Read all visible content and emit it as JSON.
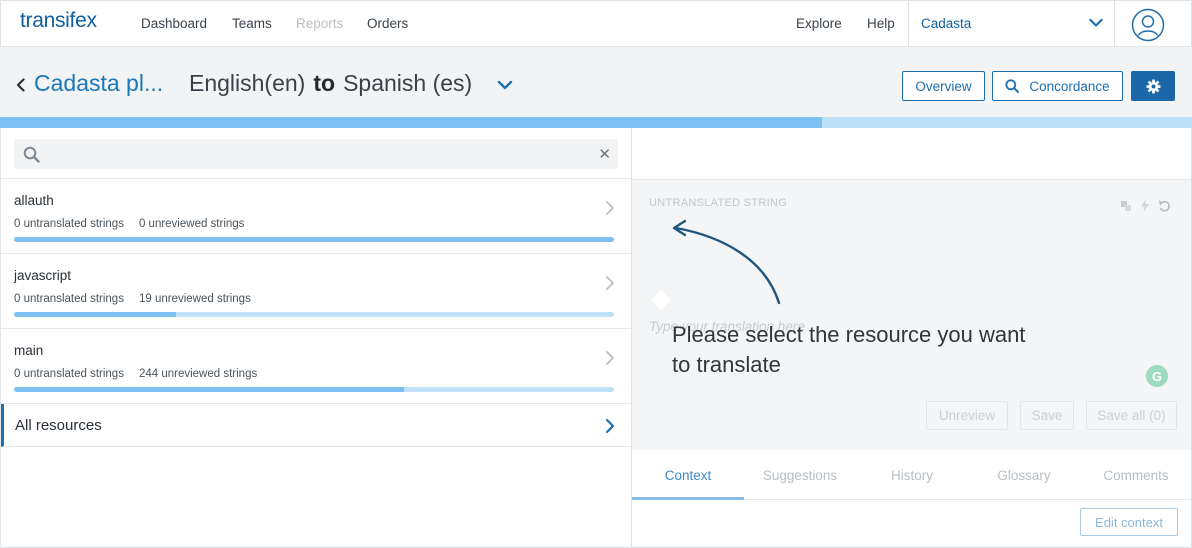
{
  "nav": {
    "logo": "transifex",
    "links": [
      "Dashboard",
      "Teams",
      "Reports",
      "Orders"
    ],
    "right_links": [
      "Explore",
      "Help"
    ],
    "project_selector": "Cadasta"
  },
  "header": {
    "project_title": "Cadasta pl...",
    "source_lang": "English(en)",
    "to_word": "to",
    "target_lang": "Spanish (es)",
    "overview_label": "Overview",
    "concordance_label": "Concordance"
  },
  "progress": {
    "fraction": 0.69
  },
  "search": {
    "value": "",
    "placeholder": ""
  },
  "resources": [
    {
      "name": "allauth",
      "untranslated": "0 untranslated strings",
      "unreviewed": "0 unreviewed strings",
      "reviewed_fraction": 1.0
    },
    {
      "name": "javascript",
      "untranslated": "0 untranslated strings",
      "unreviewed": "19 unreviewed strings",
      "reviewed_fraction": 0.27
    },
    {
      "name": "main",
      "untranslated": "0 untranslated strings",
      "unreviewed": "244 unreviewed strings",
      "reviewed_fraction": 0.65
    }
  ],
  "all_resources_label": "All resources",
  "editor": {
    "source_heading": "UNTRANSLATED STRING",
    "target_placeholder": "Type your translation here",
    "grammarly": "G",
    "unreview_label": "Unreview",
    "save_label": "Save",
    "save_all_label": "Save all (0)"
  },
  "tabs": [
    "Context",
    "Suggestions",
    "History",
    "Glossary",
    "Comments"
  ],
  "active_tab": "Context",
  "edit_context_label": "Edit context",
  "tour": {
    "message": "Please select the resource you want to translate"
  },
  "colors": {
    "brand": "#1f6fae",
    "progress_fill": "#7cc1f1",
    "progress_track": "#bde0f8"
  },
  "icons": [
    "back-chevron-icon",
    "dropdown-chevron-icon",
    "user-icon",
    "search-icon",
    "gear-icon",
    "close-icon",
    "chevron-right-icon",
    "copy-source-icon",
    "lightning-icon",
    "undo-icon"
  ]
}
